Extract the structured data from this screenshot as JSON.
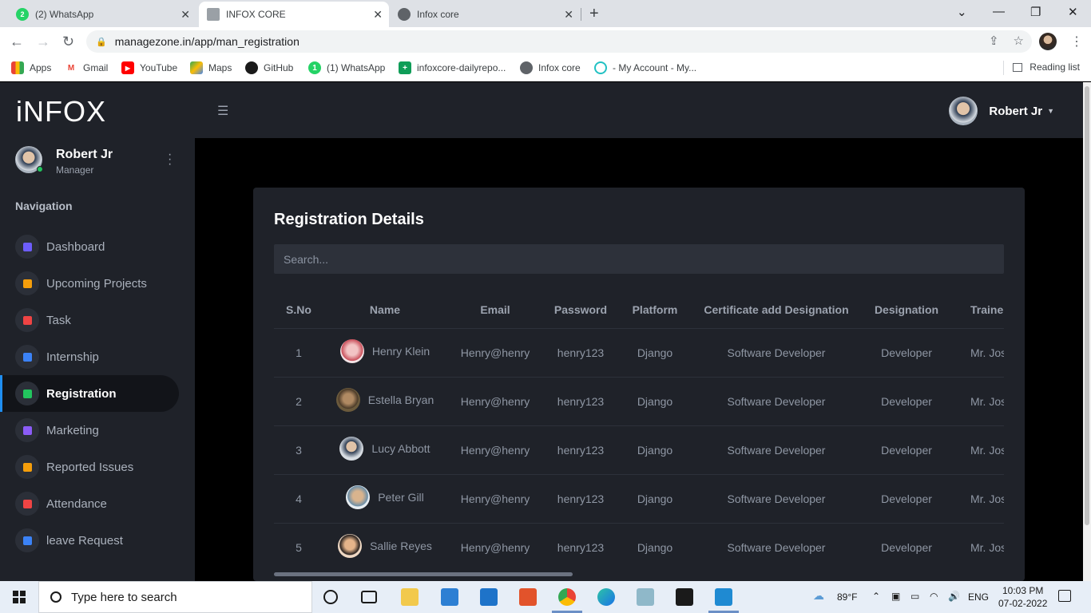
{
  "browser": {
    "tabs": [
      {
        "title": "(2) WhatsApp",
        "badge": "2"
      },
      {
        "title": "INFOX CORE"
      },
      {
        "title": "Infox core"
      }
    ],
    "url": "managezone.in/app/man_registration",
    "bookmarks": [
      "Apps",
      "Gmail",
      "YouTube",
      "Maps",
      "GitHub",
      "(1) WhatsApp",
      "infoxcore-dailyrepo...",
      "Infox core",
      "- My Account - My..."
    ],
    "reading_list": "Reading list"
  },
  "app": {
    "logo": "iNFOX",
    "user": {
      "name": "Robert Jr",
      "role": "Manager"
    },
    "nav_title": "Navigation",
    "nav": [
      {
        "label": "Dashboard",
        "color": "#6d5dfc"
      },
      {
        "label": "Upcoming Projects",
        "color": "#f59e0b"
      },
      {
        "label": "Task",
        "color": "#ef4444"
      },
      {
        "label": "Internship",
        "color": "#3b82f6"
      },
      {
        "label": "Registration",
        "color": "#22c55e",
        "active": true
      },
      {
        "label": "Marketing",
        "color": "#8b5cf6"
      },
      {
        "label": "Reported Issues",
        "color": "#f59e0b"
      },
      {
        "label": "Attendance",
        "color": "#ef4444"
      },
      {
        "label": "leave Request",
        "color": "#3b82f6"
      }
    ],
    "topbar_user": "Robert Jr"
  },
  "card": {
    "title": "Registration Details",
    "search_placeholder": "Search...",
    "columns": [
      "S.No",
      "Name",
      "Email",
      "Password",
      "Platform",
      "Certificate add Designation",
      "Designation",
      "Traine"
    ],
    "rows": [
      {
        "sno": "1",
        "name": "Henry Klein",
        "email": "Henry@henry",
        "password": "henry123",
        "platform": "Django",
        "certificate": "Software Developer",
        "designation": "Developer",
        "trainer": "Mr. Jose"
      },
      {
        "sno": "2",
        "name": "Estella Bryan",
        "email": "Henry@henry",
        "password": "henry123",
        "platform": "Django",
        "certificate": "Software Developer",
        "designation": "Developer",
        "trainer": "Mr. Jose"
      },
      {
        "sno": "3",
        "name": "Lucy Abbott",
        "email": "Henry@henry",
        "password": "henry123",
        "platform": "Django",
        "certificate": "Software Developer",
        "designation": "Developer",
        "trainer": "Mr. Jose"
      },
      {
        "sno": "4",
        "name": "Peter Gill",
        "email": "Henry@henry",
        "password": "henry123",
        "platform": "Django",
        "certificate": "Software Developer",
        "designation": "Developer",
        "trainer": "Mr. Jose"
      },
      {
        "sno": "5",
        "name": "Sallie Reyes",
        "email": "Henry@henry",
        "password": "henry123",
        "platform": "Django",
        "certificate": "Software Developer",
        "designation": "Developer",
        "trainer": "Mr. Jose"
      }
    ]
  },
  "taskbar": {
    "search_placeholder": "Type here to search",
    "weather": "89°F",
    "lang": "ENG",
    "time": "10:03 PM",
    "date": "07-02-2022"
  }
}
